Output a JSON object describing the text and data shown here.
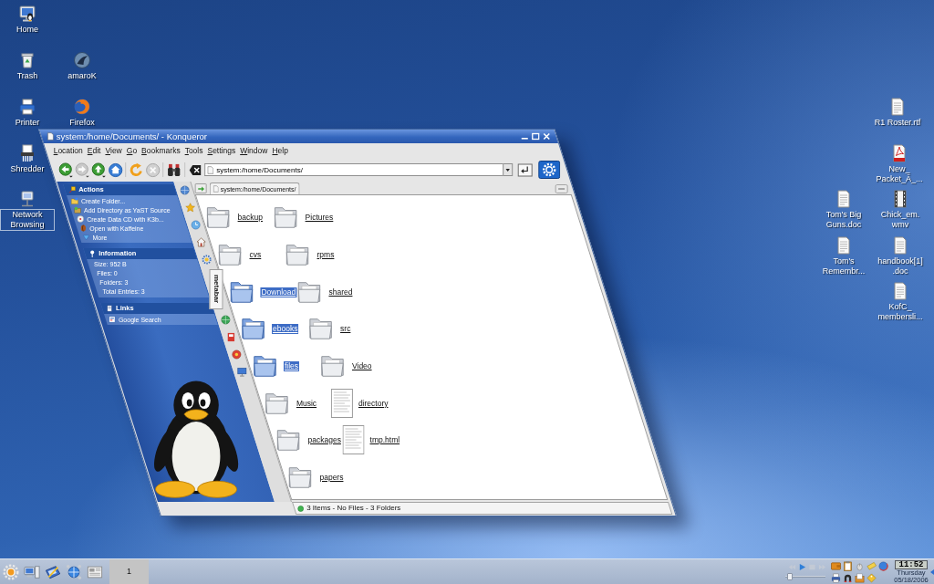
{
  "desktop_icons": [
    {
      "label": "Home",
      "selected": false
    },
    {
      "label": "Trash",
      "selected": false
    },
    {
      "label": "amaroK",
      "selected": false
    },
    {
      "label": "Printer",
      "selected": false
    },
    {
      "label": "Firefox",
      "selected": false
    },
    {
      "label": "Shredder",
      "selected": false
    },
    {
      "label": "Network Browsing",
      "selected": true
    },
    {
      "label": "R1 Roster.rtf",
      "selected": false
    },
    {
      "label": "New_\nPacket_Ã_...",
      "selected": false
    },
    {
      "label": "Tom's Big Guns.doc",
      "selected": false
    },
    {
      "label": "Chick_em.\nwmv",
      "selected": false
    },
    {
      "label": "Tom's Remembr...",
      "selected": false
    },
    {
      "label": "handbook[1]\n.doc",
      "selected": false
    },
    {
      "label": "KofC_\nmembersli...",
      "selected": false
    }
  ],
  "window": {
    "title": "system:/home/Documents/ - Konqueror",
    "menu": [
      "Location",
      "Edit",
      "View",
      "Go",
      "Bookmarks",
      "Tools",
      "Settings",
      "Window",
      "Help"
    ],
    "toolbar_buttons": [
      {
        "disabled": false
      },
      {
        "disabled": true
      },
      {
        "disabled": false
      },
      {
        "disabled": false
      },
      {
        "disabled": false
      },
      {
        "disabled": true
      },
      {
        "disabled": false
      }
    ],
    "location": "system:/home/Documents/",
    "tab": "system:/home/Documents/",
    "sidebar": {
      "sections": [
        {
          "kind": "actions",
          "title": "Actions",
          "items": [
            "Create Folder...",
            "Add Directory as YaST Source",
            "Create Data CD with K3b...",
            "Open with Kaffeine",
            "More"
          ]
        },
        {
          "kind": "info",
          "title": "Information",
          "items": [
            "Size: 952 B",
            "Files: 0",
            "Folders: 3",
            "Total Entries: 3"
          ]
        },
        {
          "kind": "links",
          "title": "Links",
          "items": [
            "Google Search"
          ]
        }
      ],
      "tabs": [
        {
          "kind": "icon",
          "selected": false
        },
        {
          "kind": "icon",
          "selected": false
        },
        {
          "kind": "icon",
          "selected": false
        },
        {
          "kind": "icon",
          "selected": false
        },
        {
          "kind": "icon",
          "selected": false
        },
        {
          "kind": "label",
          "label": "metabar",
          "selected": true
        },
        {
          "kind": "icon",
          "selected": false
        },
        {
          "kind": "icon",
          "selected": false
        },
        {
          "kind": "icon",
          "selected": false
        },
        {
          "kind": "icon",
          "selected": false
        }
      ]
    },
    "files": [
      {
        "name": "backup",
        "kind": "folder",
        "selected": false
      },
      {
        "name": "Pictures",
        "kind": "folder",
        "selected": false
      },
      {
        "name": "cvs",
        "kind": "folder",
        "selected": false
      },
      {
        "name": "rpms",
        "kind": "folder",
        "selected": false
      },
      {
        "name": "Download",
        "kind": "folder",
        "selected": true
      },
      {
        "name": "shared",
        "kind": "folder",
        "selected": false
      },
      {
        "name": "ebooks",
        "kind": "folder",
        "selected": true
      },
      {
        "name": "src",
        "kind": "folder",
        "selected": false
      },
      {
        "name": "files",
        "kind": "folder",
        "selected": true
      },
      {
        "name": "Video",
        "kind": "folder",
        "selected": false
      },
      {
        "name": "Music",
        "kind": "folder",
        "selected": false
      },
      {
        "name": "directory",
        "kind": "document",
        "selected": false
      },
      {
        "name": "packages",
        "kind": "folder",
        "selected": false
      },
      {
        "name": "tmp.html",
        "kind": "document",
        "selected": false
      },
      {
        "name": "papers",
        "kind": "folder",
        "selected": false
      }
    ],
    "status": "3 Items - No Files - 3 Folders"
  },
  "taskbar": {
    "pager": [
      {
        "label": "1",
        "selected": true
      }
    ],
    "media_buttons": [
      {
        "disabled": true
      },
      {
        "disabled": false
      },
      {
        "disabled": true
      },
      {
        "disabled": true
      }
    ],
    "volume": {
      "level": 0.05
    },
    "clock": {
      "time": "11:52",
      "day": "Thursday",
      "date": "05/18/2006"
    }
  }
}
